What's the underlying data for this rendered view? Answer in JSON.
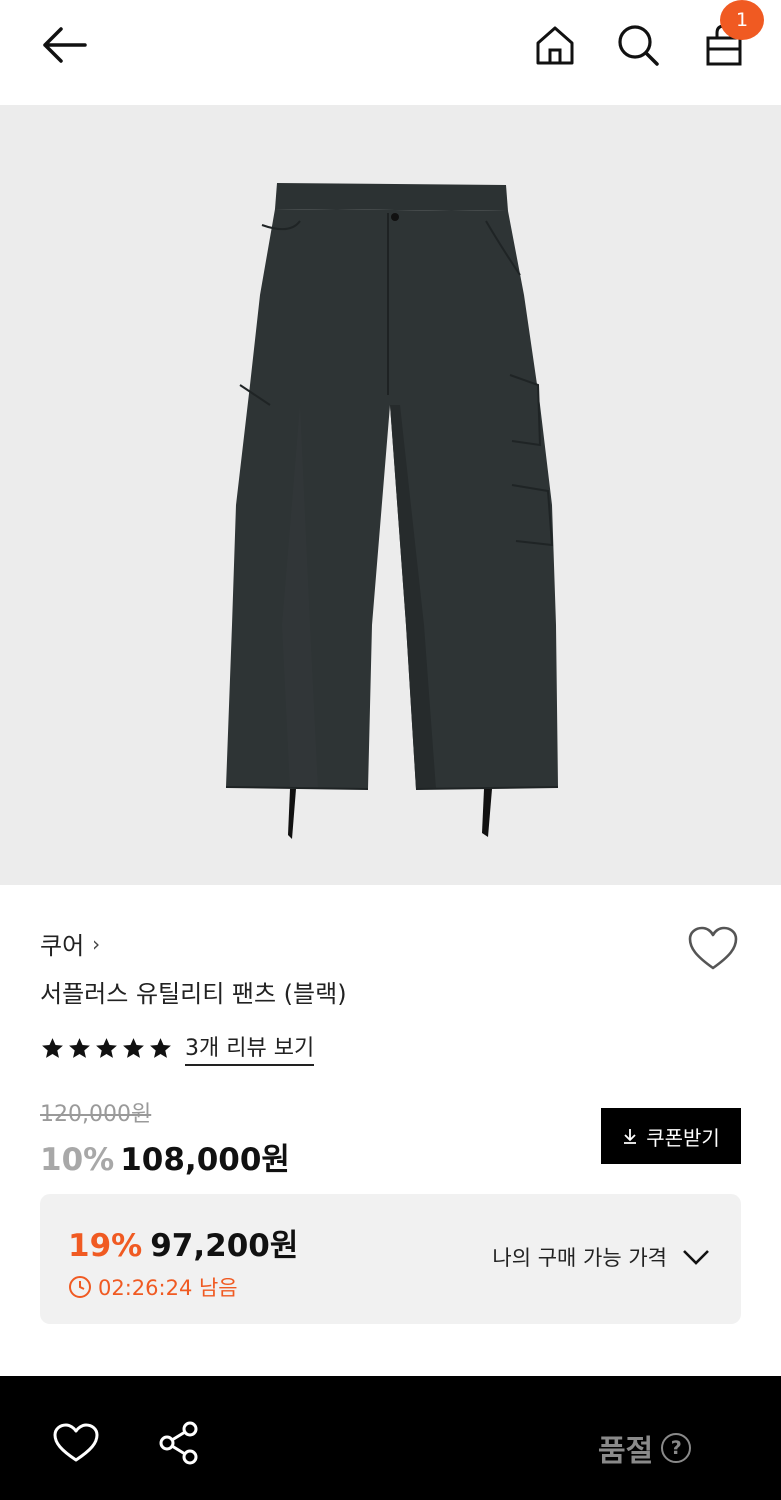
{
  "header": {
    "back_icon": "arrow-left-icon",
    "home_icon": "home-icon",
    "search_icon": "search-icon",
    "bag_icon": "shopping-bag-icon",
    "cart_count": "1"
  },
  "product": {
    "image_alt_icon": "cargo-pants-image",
    "brand": "쿠어",
    "brand_chevron": "›",
    "title": "서플러스 유틸리티 팬츠 (블랙)",
    "rating_stars": 5,
    "reviews_link": "3개 리뷰 보기",
    "original_price": "120,000원",
    "discount_rate": "10%",
    "sale_price": "108,000원",
    "coupon_button": "쿠폰받기"
  },
  "my_price": {
    "discount_rate": "19%",
    "price": "97,200원",
    "timer": "02:26:24 남음",
    "label": "나의 구매 가능 가격"
  },
  "bottom_bar": {
    "soldout_label": "품절",
    "help_glyph": "?"
  },
  "colors": {
    "accent": "#f05a22",
    "image_bg": "#ececec",
    "bottom_bar": "#000000"
  }
}
